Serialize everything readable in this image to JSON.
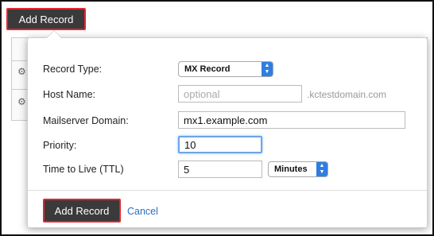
{
  "toolbar": {
    "add_record_label": "Add Record"
  },
  "form": {
    "record_type": {
      "label": "Record Type:",
      "value": "MX Record"
    },
    "host_name": {
      "label": "Host Name:",
      "placeholder": "optional",
      "suffix": ".kctestdomain.com"
    },
    "mailserver": {
      "label": "Mailserver Domain:",
      "value": "mx1.example.com"
    },
    "priority": {
      "label": "Priority:",
      "value": "10"
    },
    "ttl": {
      "label": "Time to Live (TTL)",
      "value": "5",
      "unit": "Minutes"
    }
  },
  "footer": {
    "submit_label": "Add Record",
    "cancel_label": "Cancel"
  },
  "colors": {
    "button_bg": "#3a3a3a",
    "highlight": "#e3262f",
    "link": "#2a6fc1",
    "focus": "#6aa6e8"
  }
}
